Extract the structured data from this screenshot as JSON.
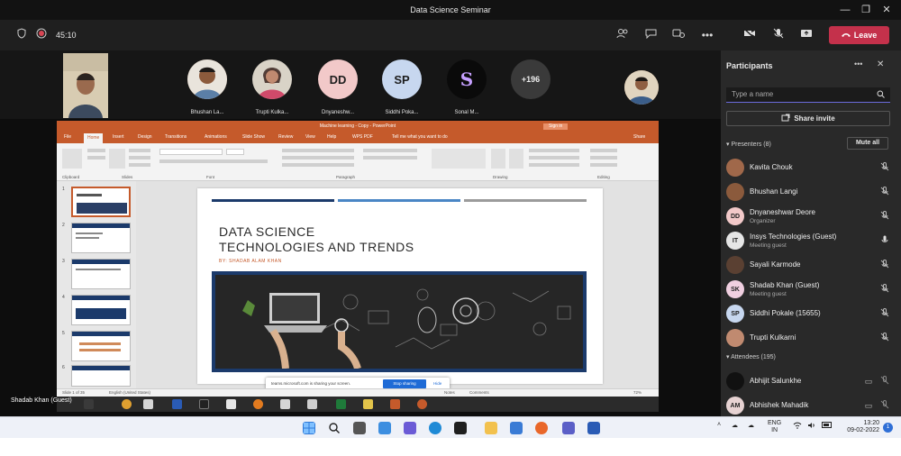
{
  "window": {
    "title": "Data Science Seminar"
  },
  "toolbar": {
    "timer": "45:10",
    "leave_label": "Leave"
  },
  "stage": {
    "tiles": [
      {
        "name": "Bhushan La...",
        "initials": "",
        "color": "#8b5a3c"
      },
      {
        "name": "Trupti Kulka...",
        "initials": "",
        "color": "#c08a70"
      },
      {
        "name": "Dnyaneshw...",
        "initials": "DD",
        "color": "#f2c9c9"
      },
      {
        "name": "Siddhi Poka...",
        "initials": "SP",
        "color": "#c7d7ef"
      },
      {
        "name": "Sonal M...",
        "initials": "S",
        "color": "#0a0a0a"
      }
    ],
    "overflow_count": "+196",
    "presenter_label": "Shadab Khan (Guest)"
  },
  "ppt": {
    "title": "Machine learning - Copy - PowerPoint",
    "signin": "Sign in",
    "tabs": [
      "File",
      "Home",
      "Insert",
      "Design",
      "Transitions",
      "Animations",
      "Slide Show",
      "Review",
      "View",
      "Help",
      "WPS PDF",
      "Tell me what you want to do"
    ],
    "share_tab": "Share",
    "ribbon_groups": [
      "Clipboard",
      "Slides",
      "Font",
      "Paragraph",
      "Drawing",
      "Editing"
    ],
    "slide_nums": [
      "1",
      "2",
      "3",
      "4",
      "5",
      "6"
    ],
    "slide_title_line1": "DATA SCIENCE",
    "slide_title_line2": "TECHNOLOGIES AND TRENDS",
    "slide_byline": "BY: SHADAB ALAM KHAN",
    "status_left": "Slide 1 of 35",
    "status_lang": "English (United States)",
    "status_notes": "Notes",
    "status_comments": "Comments",
    "status_zoom": "72%",
    "sharing_text": "teams.microsoft.com is sharing your screen.",
    "stop_sharing": "Stop sharing",
    "hide": "Hide"
  },
  "panel": {
    "title": "Participants",
    "search_placeholder": "Type a name",
    "share_invite": "Share invite",
    "presenters_label": "Presenters (8)",
    "mute_all": "Mute all",
    "presenters": [
      {
        "name": "Kavita Chouk",
        "sub": "",
        "initials": "",
        "color": "#a0684a",
        "mic": "muted"
      },
      {
        "name": "Bhushan Langi",
        "sub": "",
        "initials": "",
        "color": "#8b5a3c",
        "mic": "muted"
      },
      {
        "name": "Dnyaneshwar Deore",
        "sub": "Organizer",
        "initials": "DD",
        "color": "#f2c9c9",
        "mic": "muted"
      },
      {
        "name": "Insys Technologies (Guest)",
        "sub": "Meeting guest",
        "initials": "IT",
        "color": "#e6e6e6",
        "mic": "on"
      },
      {
        "name": "Sayali Karmode",
        "sub": "",
        "initials": "",
        "color": "#5a4032",
        "mic": "muted"
      },
      {
        "name": "Shadab Khan (Guest)",
        "sub": "Meeting guest",
        "initials": "SK",
        "color": "#f0cfe0",
        "mic": "muted"
      },
      {
        "name": "Siddhi Pokale (15655)",
        "sub": "",
        "initials": "SP",
        "color": "#c7d7ef",
        "mic": "muted"
      },
      {
        "name": "Trupti Kulkarni",
        "sub": "",
        "initials": "",
        "color": "#c08a70",
        "mic": "muted"
      }
    ],
    "attendees_label": "Attendees (195)",
    "attendees": [
      {
        "name": "Abhijit Salunkhe",
        "initials": "",
        "color": "#111111"
      },
      {
        "name": "Abhishek Mahadik",
        "initials": "AM",
        "color": "#e7d3d3"
      }
    ]
  },
  "windows_taskbar": {
    "lang": "ENG",
    "region": "IN",
    "time": "13:20",
    "date": "09-02-2022",
    "badge": "1"
  }
}
